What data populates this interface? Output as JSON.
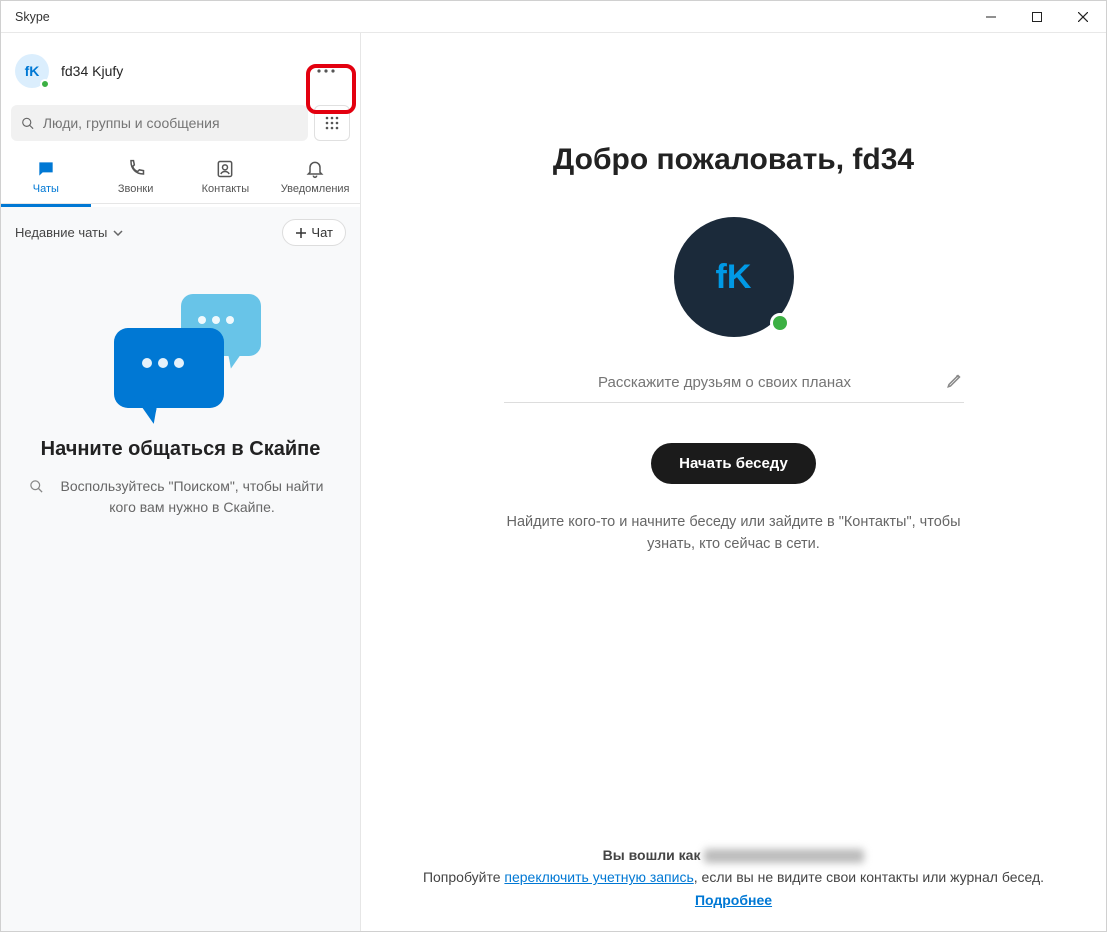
{
  "window": {
    "title": "Skype"
  },
  "profile": {
    "initials": "fK",
    "name": "fd34 Kjufy"
  },
  "search": {
    "placeholder": "Люди, группы и сообщения"
  },
  "tabs": [
    {
      "label": "Чаты"
    },
    {
      "label": "Звонки"
    },
    {
      "label": "Контакты"
    },
    {
      "label": "Уведомления"
    }
  ],
  "filter": {
    "label": "Недавние чаты",
    "new_chat": "Чат"
  },
  "empty": {
    "title": "Начните общаться в Скайпе",
    "desc": "Воспользуйтесь \"Поиском\", чтобы найти кого вам нужно в Скайпе."
  },
  "main": {
    "welcome": "Добро пожаловать, fd34",
    "avatar_initials": "fK",
    "status_placeholder": "Расскажите друзьям о своих планах",
    "start_button": "Начать беседу",
    "hint": "Найдите кого-то и начните беседу или зайдите в \"Контакты\", чтобы узнать, кто сейчас в сети."
  },
  "footer": {
    "signed_in_as": "Вы вошли как",
    "try_prefix": "Попробуйте ",
    "switch_account": "переключить учетную запись",
    "try_suffix": ", если вы не видите свои контакты или журнал бесед.",
    "learn_more": "Подробнее"
  }
}
